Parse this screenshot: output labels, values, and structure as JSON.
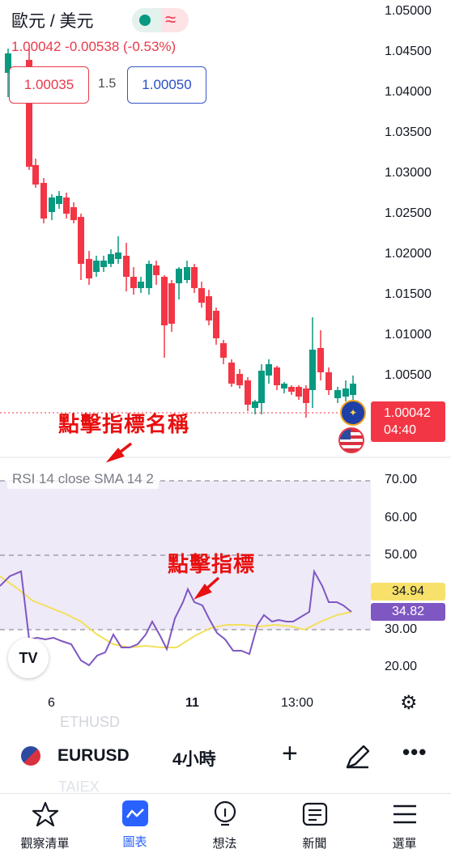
{
  "header": {
    "symbol_title": "歐元 / 美元",
    "market_status_dot_color": "#089981",
    "change_text": "1.00042  -0.00538 (-0.53%)"
  },
  "quote": {
    "sell": "1.00035",
    "spread": "1.5",
    "buy": "1.00050"
  },
  "price_axis": [
    "1.05000",
    "1.04500",
    "1.04000",
    "1.03500",
    "1.03000",
    "1.02500",
    "1.02000",
    "1.01500",
    "1.01000",
    "1.00500"
  ],
  "last_price": {
    "price": "1.00042",
    "countdown": "04:40",
    "color": "#f23645"
  },
  "indicator": {
    "label": "RSI 14 close SMA 14 2",
    "axis": [
      "70.00",
      "60.00",
      "50.00",
      "30.00",
      "20.00"
    ],
    "rsi_value": "34.94",
    "sma_value": "34.82",
    "rsi_tag_color": "#f7e16a",
    "sma_tag_color": "#7e57c2"
  },
  "time_axis": [
    "6",
    "11",
    "13:00"
  ],
  "annotations": {
    "indicator_name": "點擊指標名稱",
    "indicator": "點擊指標"
  },
  "symbol_bar": {
    "symbol": "EURUSD",
    "interval": "4小時",
    "ghost_top": "ETHUSD",
    "ghost_bottom": "TAIEX"
  },
  "nav": [
    {
      "label": "觀察清單",
      "icon": "star-icon"
    },
    {
      "label": "圖表",
      "icon": "chart-icon"
    },
    {
      "label": "想法",
      "icon": "lightbulb-icon"
    },
    {
      "label": "新聞",
      "icon": "news-icon"
    },
    {
      "label": "選單",
      "icon": "menu-icon"
    }
  ],
  "colors": {
    "up": "#089981",
    "down": "#f23645",
    "rsi_line": "#7e57c2",
    "sma_line": "#f3e05b",
    "accent": "#2962ff"
  }
}
